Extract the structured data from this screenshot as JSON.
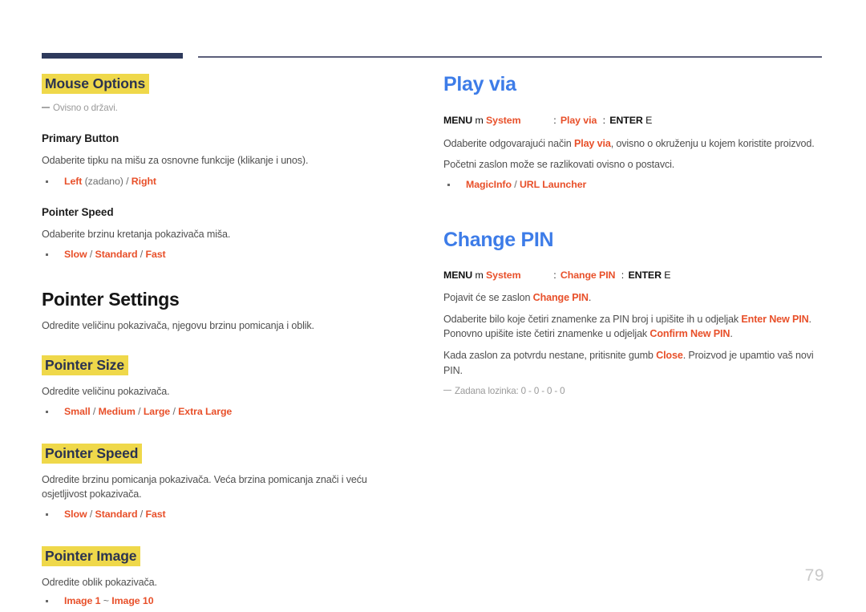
{
  "page": {
    "number": "79"
  },
  "left_column": {
    "mouse_options": {
      "heading": "Mouse Options",
      "note": "Ovisno o državi.",
      "primary_button": {
        "sub_heading": "Primary Button",
        "description": "Odaberite tipku na mišu za osnovne funkcije (klikanje i unos).",
        "bullet": {
          "opt1": "Left",
          "qualifier": "(zadano)",
          "sep": "/",
          "opt2": "Right"
        }
      },
      "pointer_speed": {
        "sub_heading": "Pointer Speed",
        "description": "Odaberite brzinu kretanja pokazivača miša.",
        "bullet": {
          "opt1": "Slow",
          "sep1": "/",
          "opt2": "Standard",
          "sep2": "/",
          "opt3": "Fast"
        }
      }
    },
    "pointer_settings": {
      "heading": "Pointer Settings",
      "description": "Odredite veličinu pokazivača, njegovu brzinu pomicanja i oblik.",
      "pointer_size": {
        "heading": "Pointer Size",
        "description": "Odredite veličinu pokazivača.",
        "bullet": {
          "opt1": "Small",
          "sep1": "/",
          "opt2": "Medium",
          "sep2": "/",
          "opt3": "Large",
          "sep3": "/",
          "opt4": "Extra Large"
        }
      },
      "pointer_speed": {
        "heading": "Pointer Speed",
        "description": "Odredite brzinu pomicanja pokazivača. Veća brzina pomicanja znači i veću osjetljivost pokazivača.",
        "bullet": {
          "opt1": "Slow",
          "sep1": "/",
          "opt2": "Standard",
          "sep2": "/",
          "opt3": "Fast"
        }
      },
      "pointer_image": {
        "heading": "Pointer Image",
        "description": "Odredite oblik pokazivača.",
        "bullet": {
          "opt1": "Image 1",
          "sep1": "~",
          "opt2": "Image 10"
        }
      }
    }
  },
  "right_column": {
    "play_via": {
      "heading": "Play via",
      "menu_path": {
        "menu": "MENU",
        "menu_glyph": "m",
        "system": "System",
        "colon1": ":",
        "item": "Play via",
        "colon2": ":",
        "enter": "ENTER",
        "enter_glyph": "E"
      },
      "paragraph1_pre": "Odaberite odgovarajući način ",
      "paragraph1_red": "Play via",
      "paragraph1_post": ", ovisno o okruženju u kojem koristite proizvod.",
      "paragraph2": "Početni zaslon može se razlikovati ovisno o postavci.",
      "bullet": {
        "opt1": "MagicInfo",
        "sep": "/",
        "opt2": "URL Launcher"
      }
    },
    "change_pin": {
      "heading": "Change PIN",
      "menu_path": {
        "menu": "MENU",
        "menu_glyph": "m",
        "system": "System",
        "colon1": ":",
        "item": "Change PIN",
        "colon2": ":",
        "enter": "ENTER",
        "enter_glyph": "E"
      },
      "paragraph1_pre": "Pojavit će se zaslon ",
      "paragraph1_red": "Change PIN",
      "paragraph1_post": ".",
      "paragraph2_pre": "Odaberite bilo koje četiri znamenke za PIN broj i upišite ih u odjeljak ",
      "paragraph2_red1": "Enter New PIN",
      "paragraph2_mid": ". Ponovno upišite iste četiri znamenke u odjeljak ",
      "paragraph2_red2": "Confirm New PIN",
      "paragraph2_post": ".",
      "paragraph3_pre": "Kada zaslon za potvrdu nestane, pritisnite gumb ",
      "paragraph3_red": "Close",
      "paragraph3_post": ". Proizvod je upamtio vaš novi PIN.",
      "note": "Zadana lozinka: 0 - 0 - 0 - 0"
    }
  }
}
